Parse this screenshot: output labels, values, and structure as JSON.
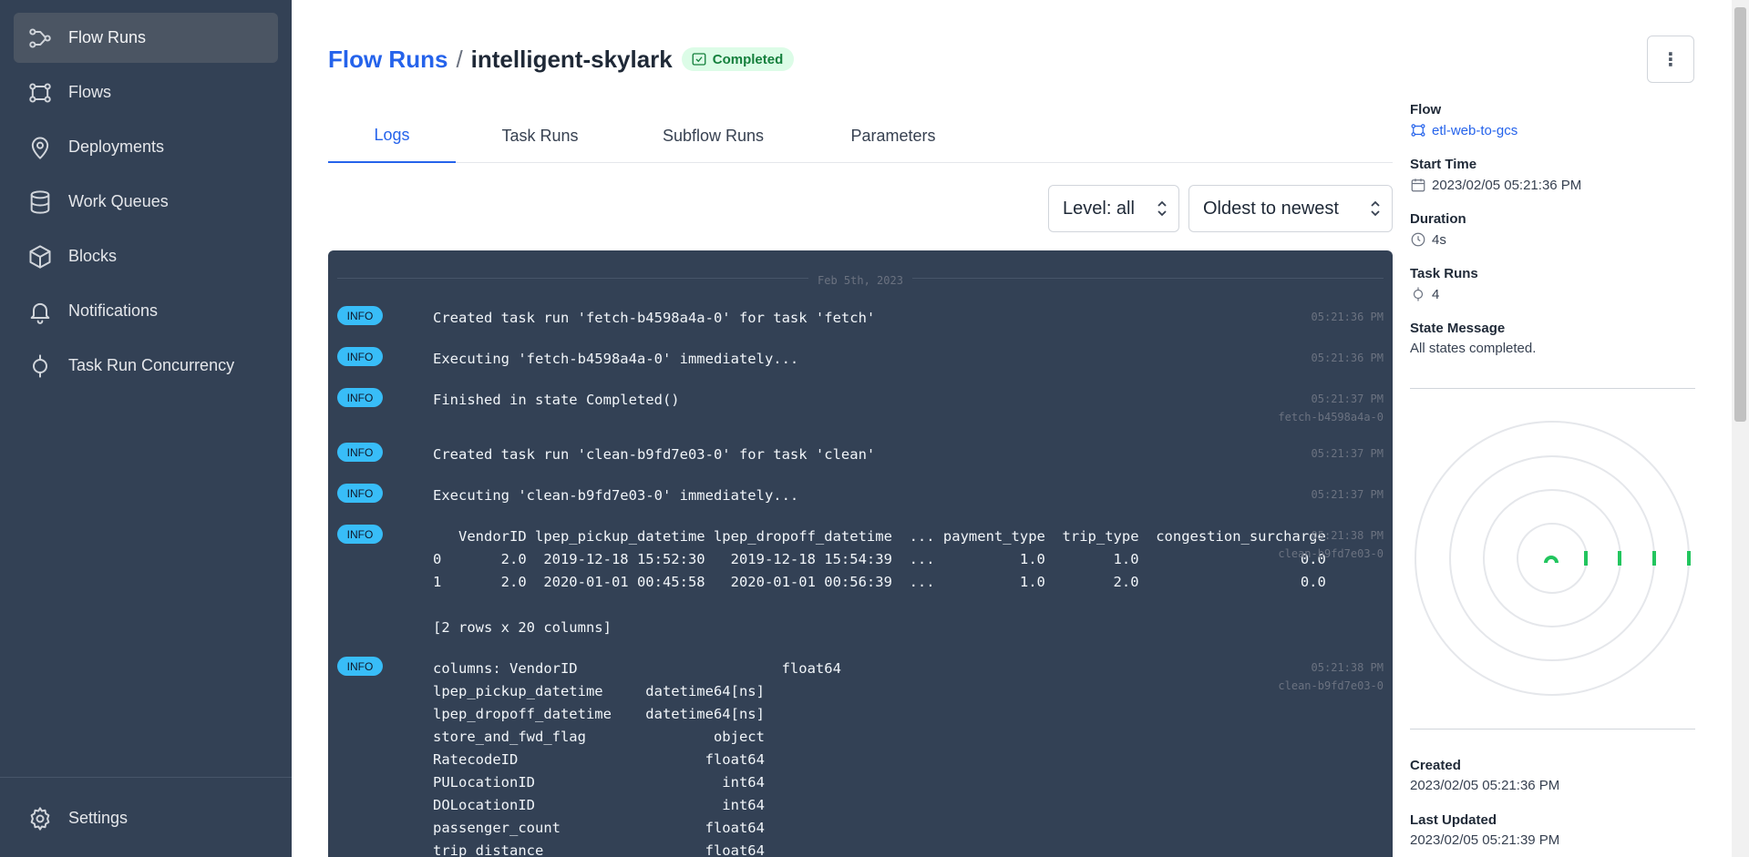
{
  "sidebar": {
    "items": [
      {
        "label": "Flow Runs",
        "icon": "flow-runs-icon",
        "active": true
      },
      {
        "label": "Flows",
        "icon": "flows-icon"
      },
      {
        "label": "Deployments",
        "icon": "map-pin-icon"
      },
      {
        "label": "Work Queues",
        "icon": "database-icon"
      },
      {
        "label": "Blocks",
        "icon": "cube-icon"
      },
      {
        "label": "Notifications",
        "icon": "bell-icon"
      },
      {
        "label": "Task Run Concurrency",
        "icon": "task-run-icon"
      }
    ],
    "settings_label": "Settings"
  },
  "header": {
    "breadcrumb_link": "Flow Runs",
    "separator": "/",
    "run_name": "intelligent-skylark",
    "status": "Completed",
    "menu_icon": "⋮"
  },
  "tabs": [
    {
      "label": "Logs",
      "active": true
    },
    {
      "label": "Task Runs"
    },
    {
      "label": "Subflow Runs"
    },
    {
      "label": "Parameters"
    }
  ],
  "filters": {
    "level": "Level: all",
    "sort": "Oldest to newest"
  },
  "logs": {
    "date": "Feb 5th, 2023",
    "entries": [
      {
        "level": "INFO",
        "message": "Created task run 'fetch-b4598a4a-0' for task 'fetch'",
        "time": "05:21:36 PM"
      },
      {
        "level": "INFO",
        "message": "Executing 'fetch-b4598a4a-0' immediately...",
        "time": "05:21:36 PM"
      },
      {
        "level": "INFO",
        "message": "Finished in state Completed()",
        "time": "05:21:37 PM\nfetch-b4598a4a-0"
      },
      {
        "level": "INFO",
        "message": "Created task run 'clean-b9fd7e03-0' for task 'clean'",
        "time": "05:21:37 PM"
      },
      {
        "level": "INFO",
        "message": "Executing 'clean-b9fd7e03-0' immediately...",
        "time": "05:21:37 PM"
      },
      {
        "level": "INFO",
        "message": "   VendorID lpep_pickup_datetime lpep_dropoff_datetime  ... payment_type  trip_type  congestion_surcharge\n0       2.0  2019-12-18 15:52:30   2019-12-18 15:54:39  ...          1.0        1.0                   0.0\n1       2.0  2020-01-01 00:45:58   2020-01-01 00:56:39  ...          1.0        2.0                   0.0\n\n[2 rows x 20 columns]",
        "time": "05:21:38 PM\nclean-b9fd7e03-0"
      },
      {
        "level": "INFO",
        "message": "columns: VendorID                        float64\nlpep_pickup_datetime     datetime64[ns]\nlpep_dropoff_datetime    datetime64[ns]\nstore_and_fwd_flag               object\nRatecodeID                      float64\nPULocationID                      int64\nDOLocationID                      int64\npassenger_count                 float64\ntrip_distance                   float64",
        "time": "05:21:38 PM\nclean-b9fd7e03-0"
      }
    ]
  },
  "details": {
    "flow": {
      "label": "Flow",
      "value": "etl-web-to-gcs"
    },
    "start_time": {
      "label": "Start Time",
      "value": "2023/02/05 05:21:36 PM"
    },
    "duration": {
      "label": "Duration",
      "value": "4s"
    },
    "task_runs": {
      "label": "Task Runs",
      "value": "4"
    },
    "state_message": {
      "label": "State Message",
      "value": "All states completed."
    },
    "created": {
      "label": "Created",
      "value": "2023/02/05 05:21:36 PM"
    },
    "last_updated": {
      "label": "Last Updated",
      "value": "2023/02/05 05:21:39 PM"
    }
  },
  "colors": {
    "sidebar_bg": "#334155",
    "accent": "#2563eb",
    "success": "#16a34a",
    "info_badge": "#38bdf8"
  }
}
